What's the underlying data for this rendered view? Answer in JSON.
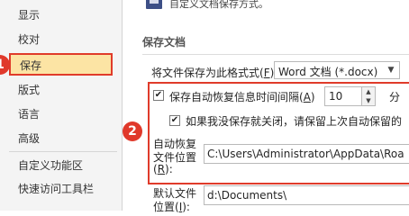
{
  "sidebar": {
    "items": [
      {
        "label": "显示"
      },
      {
        "label": "校对"
      },
      {
        "label": "保存"
      },
      {
        "label": "版式"
      },
      {
        "label": "语言"
      },
      {
        "label": "高级"
      },
      {
        "label": "自定义功能区"
      },
      {
        "label": "快速访问工具栏"
      }
    ]
  },
  "annotations": {
    "badge_1": "1",
    "badge_2": "2"
  },
  "header": {
    "partial_text": "自定义文档保存方式。"
  },
  "save_section": {
    "title": "保存文档",
    "format_label": "将文件保存为此格式式(",
    "format_key": "F",
    "format_label_end": "):",
    "format_value": "Word 文档 (*.docx)",
    "autorecover_label": "保存自动恢复信息时间间隔(",
    "autorecover_key": "A",
    "autorecover_label_end": ")",
    "autorecover_checked": "✔",
    "autorecover_minutes": "10",
    "minutes_unit": "分",
    "keep_last_label": "如果我没保存就关闭，请保留上次自动保留的",
    "keep_last_checked": "✔",
    "recover_location_line1": "自动恢复",
    "recover_location_line2": "文件位置",
    "recover_location_key": "R",
    "recover_location_end": "):",
    "recover_location_value": "C:\\Users\\Administrator\\AppData\\Roa",
    "default_location_line1": "默认文件",
    "default_location_line2": "位置(",
    "default_location_key": "I",
    "default_location_end": "):",
    "default_location_value": "d:\\Documents\\"
  },
  "colors": {
    "highlight_border": "#e03b2a",
    "selected_fill": "#fce4a4"
  }
}
